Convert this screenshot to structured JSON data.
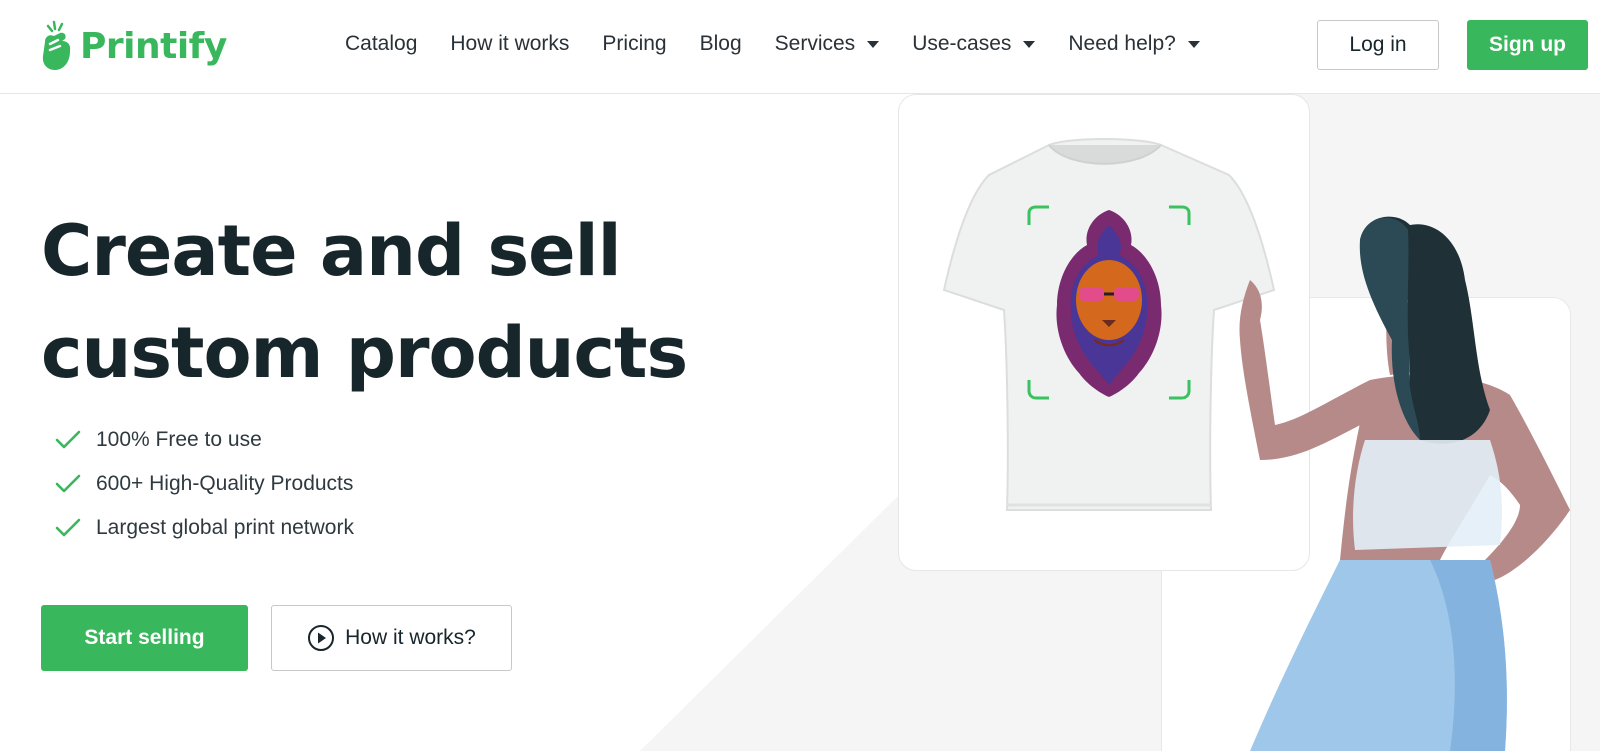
{
  "brand": {
    "name": "Printify",
    "accent": "#39b75d"
  },
  "nav": {
    "items": [
      {
        "label": "Catalog",
        "dropdown": false
      },
      {
        "label": "How it works",
        "dropdown": false
      },
      {
        "label": "Pricing",
        "dropdown": false
      },
      {
        "label": "Blog",
        "dropdown": false
      },
      {
        "label": "Services",
        "dropdown": true
      },
      {
        "label": "Use-cases",
        "dropdown": true
      },
      {
        "label": "Need help?",
        "dropdown": true
      }
    ]
  },
  "auth": {
    "login_label": "Log in",
    "signup_label": "Sign up"
  },
  "hero": {
    "title_line1": "Create and sell",
    "title_line2": "custom products",
    "features": [
      "100% Free to use",
      "600+ High-Quality Products",
      "Largest global print network"
    ],
    "cta_primary": "Start selling",
    "cta_secondary": "How it works?"
  },
  "icons": {
    "logo": "printify-hand-icon",
    "feature": "checkmark-icon",
    "video": "play-circle-icon",
    "dropdown": "caret-down-icon"
  },
  "colors": {
    "text": "#17262b",
    "green": "#39b75d",
    "hero_bg": "#f5f5f5"
  }
}
